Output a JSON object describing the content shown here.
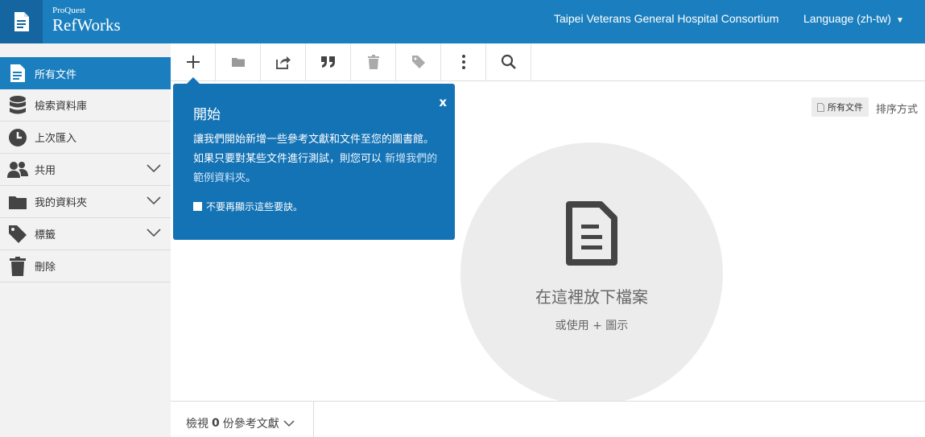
{
  "header": {
    "logo_small": "ProQuest",
    "logo_big": "RefWorks",
    "institution": "Taipei Veterans General Hospital Consortium",
    "language": "Language (zh-tw)",
    "color": "#1b7fbf"
  },
  "sidebar": {
    "items": [
      {
        "label": "所有文件",
        "icon": "document-icon",
        "active": true
      },
      {
        "label": "檢索資料庫",
        "icon": "database-icon"
      },
      {
        "label": "上次匯入",
        "icon": "clock-icon"
      },
      {
        "label": "共用",
        "icon": "users-icon",
        "expandable": true
      },
      {
        "label": "我的資料夾",
        "icon": "folder-icon",
        "expandable": true
      },
      {
        "label": "標籤",
        "icon": "tag-icon",
        "expandable": true
      },
      {
        "label": "刪除",
        "icon": "trash-icon"
      }
    ]
  },
  "toolbar": {
    "buttons": [
      "add-icon",
      "folder-icon",
      "share-icon",
      "quote-icon",
      "trash-icon",
      "tag-icon",
      "more-icon",
      "search-icon"
    ]
  },
  "popover": {
    "title": "開始",
    "close": "x",
    "body": "讓我們開始新增一些參考文獻和文件至您的圖書館。如果只要對某些文件進行測試，則您可以",
    "link": "新增我們的範例資料夾",
    "end": "。",
    "checkbox": "不要再顯示這些要訣。"
  },
  "sort": {
    "chip": "所有文件",
    "label": "排序方式"
  },
  "dropzone": {
    "title": "在這裡放下檔案",
    "subtitle": "或使用 + 圖示"
  },
  "footer": {
    "prefix": "檢視",
    "count": "0",
    "suffix": "份參考文獻"
  }
}
